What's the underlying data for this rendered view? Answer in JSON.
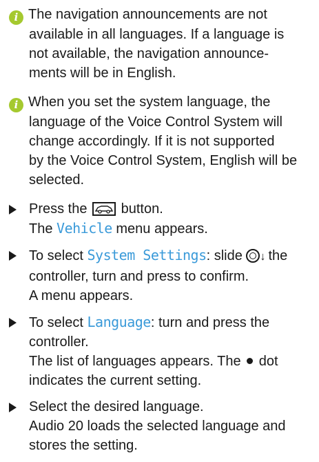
{
  "note1": {
    "line1": "The navigation announcements are not",
    "line2": "available in all languages. If a language is",
    "line3": "not available, the navigation announce-",
    "line4": "ments will be in English."
  },
  "note2": {
    "line1": "When you set the system language, the",
    "line2": "language of the Voice Control System will",
    "line3": "change accordingly. If it is not supported",
    "line4": "by the Voice Control System, English will be",
    "line5": "selected."
  },
  "step1": {
    "pre": "Press the",
    "post": "button.",
    "result_pre": "The",
    "result_key": "Vehicle",
    "result_post": "menu appears.",
    "icon": "vehicle-button-icon"
  },
  "step2": {
    "pre": "To select",
    "key": "System Settings",
    "post": ": slide",
    "post2": "the",
    "line2": "controller, turn and press to confirm.",
    "line3": "A menu appears.",
    "icon": "controller-icon"
  },
  "step3": {
    "pre": "To select",
    "key": "Language",
    "post": ": turn and press the",
    "line2": "controller.",
    "line3_pre": "The list of languages appears. The",
    "line3_post": "dot",
    "line4": "indicates the current setting."
  },
  "step4": {
    "line1": "Select the desired language.",
    "line2": "Audio 20 loads the selected language and",
    "line3": "stores the setting."
  },
  "colors": {
    "info_icon": "#a5c92f",
    "key_text": "#3a9ad9"
  }
}
